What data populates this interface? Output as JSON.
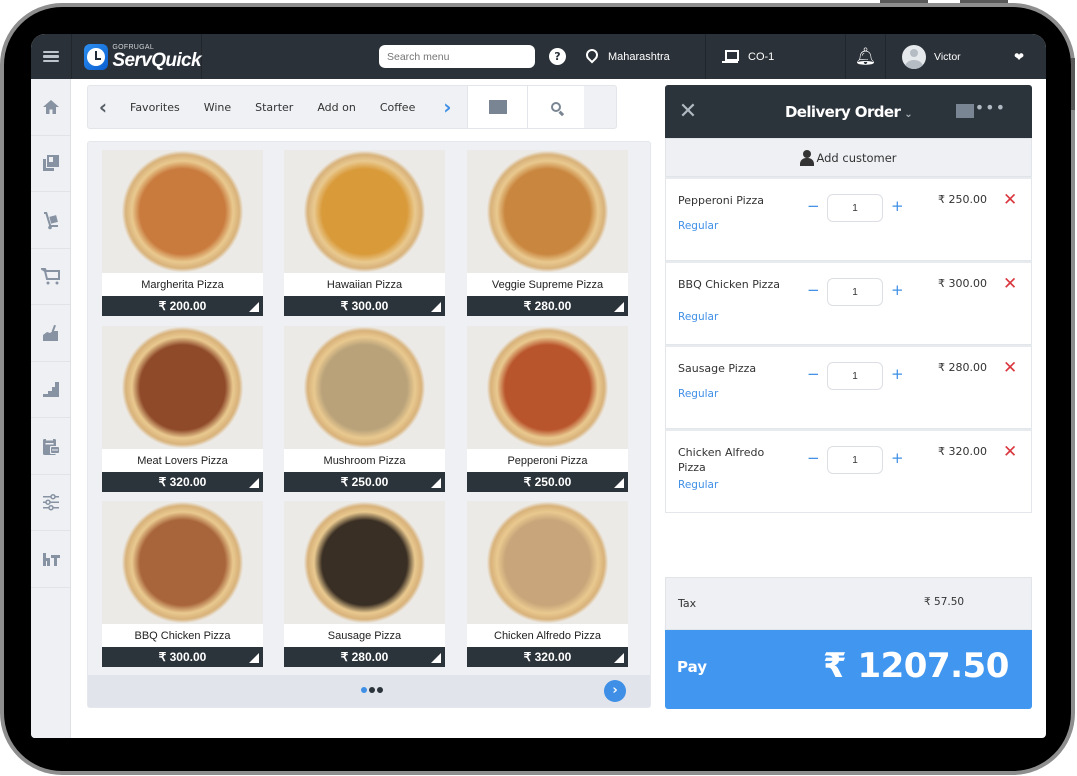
{
  "app": {
    "brand": "GOFRUGAL",
    "name": "ServQuick"
  },
  "topbar": {
    "search_placeholder": "Search menu",
    "help_icon": "?",
    "location": "Maharashtra",
    "counter": "CO-1",
    "user": "Victor"
  },
  "sidebar": {
    "items": [
      {
        "icon": "home-icon"
      },
      {
        "icon": "catalog-icon"
      },
      {
        "icon": "trolley-icon"
      },
      {
        "icon": "cart-icon"
      },
      {
        "icon": "kitchen-icon"
      },
      {
        "icon": "reports-icon"
      },
      {
        "icon": "clipboard-icon"
      },
      {
        "icon": "settings-sliders-icon"
      },
      {
        "icon": "hardware-icon"
      }
    ]
  },
  "categories": {
    "items": [
      "Favorites",
      "Wine",
      "Starter",
      "Add on",
      "Coffee"
    ]
  },
  "products": [
    {
      "name": "Margherita Pizza",
      "price": "₹ 200.00",
      "color": "#c97a3d"
    },
    {
      "name": "Hawaiian Pizza",
      "price": "₹ 300.00",
      "color": "#d99a3a"
    },
    {
      "name": "Veggie Supreme Pizza",
      "price": "₹ 280.00",
      "color": "#c9863f"
    },
    {
      "name": "Meat Lovers Pizza",
      "price": "₹ 320.00",
      "color": "#8f4a2a"
    },
    {
      "name": "Mushroom Pizza",
      "price": "₹ 250.00",
      "color": "#b9a27a"
    },
    {
      "name": "Pepperoni Pizza",
      "price": "₹ 250.00",
      "color": "#b9552d"
    },
    {
      "name": "BBQ Chicken Pizza",
      "price": "₹ 300.00",
      "color": "#a8643a"
    },
    {
      "name": "Sausage Pizza",
      "price": "₹ 280.00",
      "color": "#3a2f24"
    },
    {
      "name": "Chicken Alfredo Pizza",
      "price": "₹ 320.00",
      "color": "#c8a57a"
    }
  ],
  "pager": {
    "pages": 3,
    "current": 1
  },
  "order": {
    "title": "Delivery Order",
    "add_customer": "Add customer",
    "items": [
      {
        "name": "Pepperoni Pizza",
        "variant": "Regular",
        "qty": "1",
        "price": "₹ 250.00"
      },
      {
        "name": "BBQ Chicken Pizza",
        "variant": "Regular",
        "qty": "1",
        "price": "₹ 300.00"
      },
      {
        "name": "Sausage Pizza",
        "variant": "Regular",
        "qty": "1",
        "price": "₹ 280.00"
      },
      {
        "name": "Chicken Alfredo Pizza",
        "variant": "Regular",
        "qty": "1",
        "price": "₹ 320.00"
      }
    ],
    "tax_label": "Tax",
    "tax_value": "₹ 57.50",
    "pay_label": "Pay",
    "pay_amount": "₹ 1207.50"
  },
  "colors": {
    "accent": "#3f8fe6",
    "pay": "#4197f0",
    "topbar": "#2a3138",
    "remove": "#d9363e"
  }
}
